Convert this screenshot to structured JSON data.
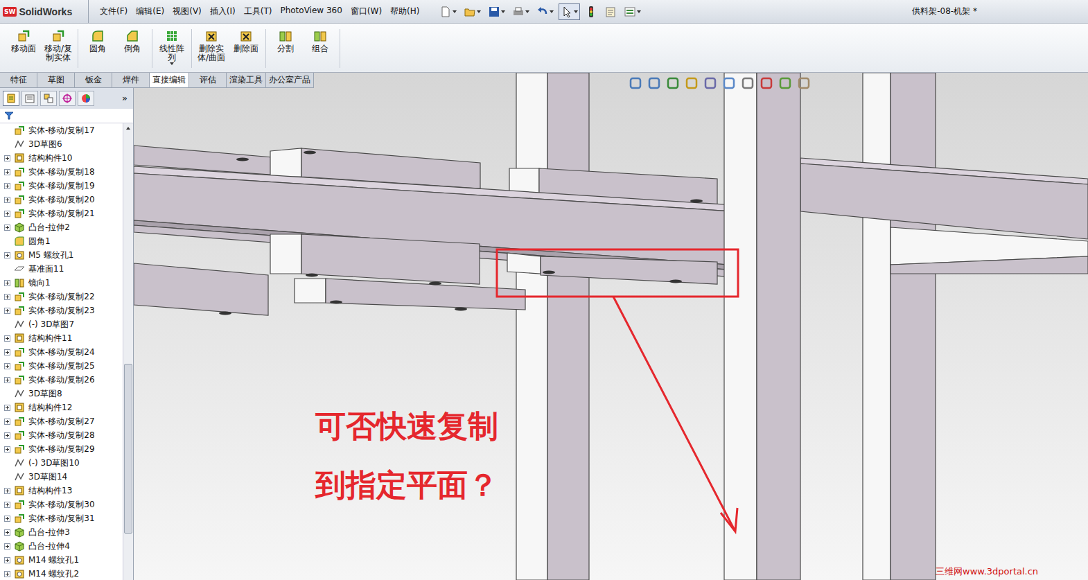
{
  "app": {
    "logo_badge": "SW",
    "logo_text": "SolidWorks",
    "title": "供料架-08-机架 *"
  },
  "menu": [
    "文件(F)",
    "编辑(E)",
    "视图(V)",
    "插入(I)",
    "工具(T)",
    "PhotoView 360",
    "窗口(W)",
    "帮助(H)"
  ],
  "quick_tools": [
    {
      "kind": "new",
      "menu": true,
      "selected": false
    },
    {
      "kind": "open",
      "menu": true,
      "selected": false
    },
    {
      "kind": "save",
      "menu": true,
      "selected": false
    },
    {
      "kind": "print",
      "menu": true,
      "selected": false
    },
    {
      "kind": "undo",
      "menu": true,
      "selected": false
    },
    {
      "kind": "select",
      "menu": true,
      "selected": true
    },
    {
      "kind": "rebuild",
      "menu": false,
      "selected": false
    },
    {
      "kind": "properties",
      "menu": false,
      "selected": false
    },
    {
      "kind": "options",
      "menu": true,
      "selected": false
    }
  ],
  "ribbon": {
    "groups": [
      [
        {
          "label": "移动面",
          "kind": "move-face"
        },
        {
          "label": "移动/复制实体",
          "kind": "move-copy"
        }
      ],
      [
        {
          "label": "圆角",
          "kind": "fillet"
        },
        {
          "label": "倒角",
          "kind": "chamfer"
        }
      ],
      [
        {
          "label": "线性阵列",
          "kind": "pattern",
          "menu": true
        }
      ],
      [
        {
          "label": "删除实体/曲面",
          "kind": "delete-body"
        },
        {
          "label": "删除面",
          "kind": "delete-face"
        }
      ],
      [
        {
          "label": "分割",
          "kind": "split"
        },
        {
          "label": "组合",
          "kind": "combine"
        }
      ]
    ]
  },
  "tabs": [
    {
      "label": "特征",
      "selected": false
    },
    {
      "label": "草图",
      "selected": false
    },
    {
      "label": "钣金",
      "selected": false
    },
    {
      "label": "焊件",
      "selected": false
    },
    {
      "label": "直接编辑",
      "selected": true
    },
    {
      "label": "评估",
      "selected": false
    },
    {
      "label": "渲染工具",
      "selected": false
    },
    {
      "label": "办公室产品",
      "selected": false
    }
  ],
  "panel_tabs": [
    {
      "kind": "feature",
      "selected": true
    },
    {
      "kind": "property",
      "selected": false
    },
    {
      "kind": "config",
      "selected": false
    },
    {
      "kind": "dimxpert",
      "selected": false
    },
    {
      "kind": "display",
      "selected": false
    }
  ],
  "panel_more": "»",
  "tree": {
    "scrollbar": {
      "level": 0.86
    },
    "items": [
      {
        "label": "实体-移动/复制17",
        "kind": "move",
        "expandable": false,
        "expanded": false
      },
      {
        "label": "3D草图6",
        "kind": "sketch",
        "expandable": false,
        "expanded": false
      },
      {
        "label": "结构构件10",
        "kind": "structure",
        "expandable": true,
        "expanded": false
      },
      {
        "label": "实体-移动/复制18",
        "kind": "move",
        "expandable": true,
        "expanded": false
      },
      {
        "label": "实体-移动/复制19",
        "kind": "move",
        "expandable": true,
        "expanded": false
      },
      {
        "label": "实体-移动/复制20",
        "kind": "move",
        "expandable": true,
        "expanded": false
      },
      {
        "label": "实体-移动/复制21",
        "kind": "move",
        "expandable": true,
        "expanded": false
      },
      {
        "label": "凸台-拉伸2",
        "kind": "boss",
        "expandable": true,
        "expanded": false
      },
      {
        "label": "圆角1",
        "kind": "fillet",
        "expandable": false,
        "expanded": false
      },
      {
        "label": "M5 螺纹孔1",
        "kind": "hole",
        "expandable": true,
        "expanded": false
      },
      {
        "label": "基准面11",
        "kind": "plane",
        "expandable": false,
        "expanded": false
      },
      {
        "label": "镜向1",
        "kind": "mirror",
        "expandable": true,
        "expanded": false
      },
      {
        "label": "实体-移动/复制22",
        "kind": "move",
        "expandable": true,
        "expanded": false
      },
      {
        "label": "实体-移动/复制23",
        "kind": "move",
        "expandable": true,
        "expanded": false
      },
      {
        "label": "(-) 3D草图7",
        "kind": "sketch",
        "expandable": false,
        "expanded": false
      },
      {
        "label": "结构构件11",
        "kind": "structure",
        "expandable": true,
        "expanded": false
      },
      {
        "label": "实体-移动/复制24",
        "kind": "move",
        "expandable": true,
        "expanded": false
      },
      {
        "label": "实体-移动/复制25",
        "kind": "move",
        "expandable": true,
        "expanded": false
      },
      {
        "label": "实体-移动/复制26",
        "kind": "move",
        "expandable": true,
        "expanded": false
      },
      {
        "label": "3D草图8",
        "kind": "sketch",
        "expandable": false,
        "expanded": false
      },
      {
        "label": "结构构件12",
        "kind": "structure",
        "expandable": true,
        "expanded": false
      },
      {
        "label": "实体-移动/复制27",
        "kind": "move",
        "expandable": true,
        "expanded": false
      },
      {
        "label": "实体-移动/复制28",
        "kind": "move",
        "expandable": true,
        "expanded": false
      },
      {
        "label": "实体-移动/复制29",
        "kind": "move",
        "expandable": true,
        "expanded": false
      },
      {
        "label": "(-) 3D草图10",
        "kind": "sketch",
        "expandable": false,
        "expanded": false
      },
      {
        "label": "3D草图14",
        "kind": "sketch",
        "expandable": false,
        "expanded": false
      },
      {
        "label": "结构构件13",
        "kind": "structure",
        "expandable": true,
        "expanded": false
      },
      {
        "label": "实体-移动/复制30",
        "kind": "move",
        "expandable": true,
        "expanded": false
      },
      {
        "label": "实体-移动/复制31",
        "kind": "move",
        "expandable": true,
        "expanded": false
      },
      {
        "label": "凸台-拉伸3",
        "kind": "boss",
        "expandable": true,
        "expanded": false
      },
      {
        "label": "凸台-拉伸4",
        "kind": "boss",
        "expandable": true,
        "expanded": false
      },
      {
        "label": "M14 螺纹孔1",
        "kind": "hole",
        "expandable": true,
        "expanded": false
      },
      {
        "label": "M14 螺纹孔2",
        "kind": "hole",
        "expandable": true,
        "expanded": false
      }
    ]
  },
  "viewport": {
    "question_lines": [
      "可否快速复制",
      "到指定平面？"
    ],
    "watermark": "三维网www.3dportal.cn"
  }
}
